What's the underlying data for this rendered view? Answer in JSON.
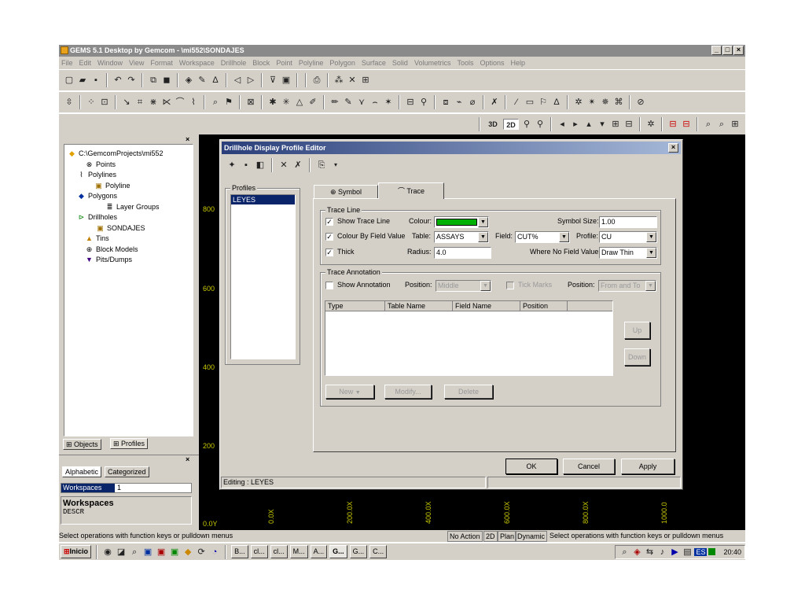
{
  "window": {
    "title": "GEMS 5.1 Desktop by Gemcom - \\mi552\\SONDAJES",
    "minimize": "_",
    "maximize": "□",
    "close": "×"
  },
  "menu": [
    "File",
    "Edit",
    "Window",
    "View",
    "Format",
    "Workspace",
    "Drillhole",
    "Block",
    "Point",
    "Polyline",
    "Polygon",
    "Surface",
    "Solid",
    "Volumetrics",
    "Tools",
    "Options",
    "Help"
  ],
  "view_toolbar": {
    "btn_3d": "3D",
    "btn_2d": "2D"
  },
  "panel_close": "×",
  "tree": {
    "root": "C:\\GemcomProjects\\mi552",
    "points": "Points",
    "polylines": "Polylines",
    "polyline": "Polyline",
    "polygons": "Polygons",
    "layer_groups": "Layer Groups",
    "drillholes": "Drillholes",
    "sondajes": "SONDAJES",
    "tins": "Tins",
    "block_models": "Block Models",
    "pits_dumps": "Pits/Dumps"
  },
  "bottom_tabs": {
    "objects": "Objects",
    "profiles": "Profiles"
  },
  "props": {
    "tab_alpha": "Alphabetic",
    "tab_cat": "Categorized",
    "row_key": "Workspaces",
    "row_val": "1",
    "desc_title": "Workspaces",
    "desc_text": "DESCR"
  },
  "plot": {
    "y_ticks": [
      "800",
      "600",
      "400",
      "200",
      "0.0Y"
    ],
    "x_ticks": [
      "0.0X",
      "200.0X",
      "400.0X",
      "600.0X",
      "800.0X",
      "1000.0"
    ]
  },
  "dialog": {
    "title": "Drillhole Display Profile Editor",
    "close": "×",
    "profiles_label": "Profiles",
    "profiles": [
      "LEYES"
    ],
    "tab_symbol": "Symbol",
    "tab_trace": "Trace",
    "trace_line_label": "Trace Line",
    "show_trace_line": "Show Trace Line",
    "colour_label": "Colour:",
    "colour_value": "#00b000",
    "symbol_size_label": "Symbol Size:",
    "symbol_size": "1.00",
    "colour_by_field": "Colour By Field Value",
    "table_label": "Table:",
    "table_value": "ASSAYS",
    "field_label": "Field:",
    "field_value": "CUT%",
    "profile_label": "Profile:",
    "profile_value": "CU",
    "thick": "Thick",
    "radius_label": "Radius:",
    "radius_value": "4.0",
    "where_no_field": "Where No Field Value",
    "where_no_field_value": "Draw Thin",
    "annotation_label": "Trace Annotation",
    "show_annotation": "Show Annotation",
    "position_label": "Position:",
    "position_value": "Middle",
    "tick_marks": "Tick Marks",
    "position2_label": "Position:",
    "position2_value": "From and To",
    "table_headers": [
      "Type",
      "Table Name",
      "Field Name",
      "Position"
    ],
    "btn_up": "Up",
    "btn_down": "Down",
    "btn_new": "New",
    "btn_modify": "Modify...",
    "btn_delete": "Delete",
    "btn_ok": "OK",
    "btn_cancel": "Cancel",
    "btn_apply": "Apply",
    "editing": "Editing : LEYES"
  },
  "status": {
    "left": "Select operations with function keys or pulldown menus",
    "no_action": "No Action",
    "mode_2d": "2D",
    "plan": "Plan",
    "dynamic": "Dynamic",
    "right": "Select operations with function keys or pulldown menus"
  },
  "taskbar": {
    "start": "Inicio",
    "items": [
      "B...",
      "cl...",
      "cl...",
      "M...",
      "A...",
      "G...",
      "G...",
      "C..."
    ],
    "clock": "20:40",
    "lang": "ES"
  }
}
